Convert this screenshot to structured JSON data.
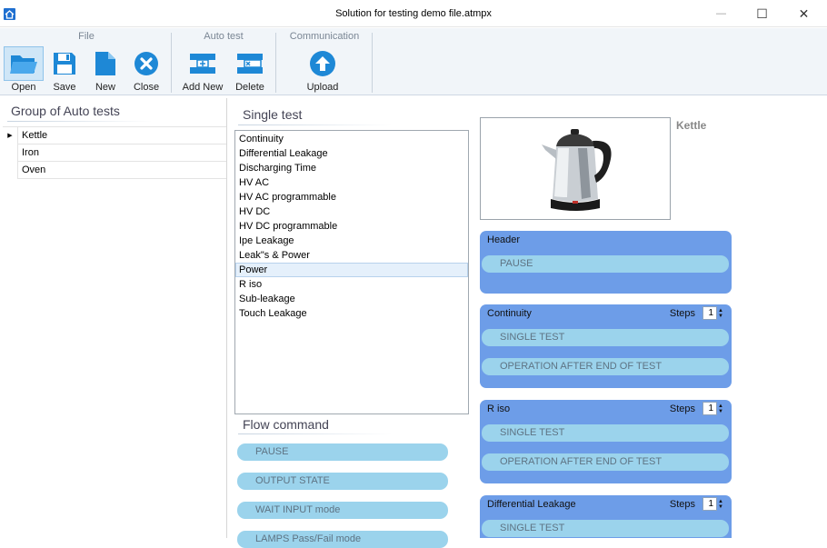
{
  "window": {
    "title": "Solution for testing demo file.atmpx",
    "minimize": "—",
    "maximize": "☐",
    "close": "✕"
  },
  "ribbon": {
    "groups": {
      "file": "File",
      "auto_test": "Auto test",
      "communication": "Communication"
    },
    "buttons": {
      "open": "Open",
      "save": "Save",
      "new": "New",
      "close": "Close",
      "add_new": "Add New",
      "delete": "Delete",
      "upload": "Upload"
    }
  },
  "left": {
    "title": "Group of Auto tests",
    "rows": [
      "Kettle",
      "Iron",
      "Oven"
    ],
    "selected_marker": "▶"
  },
  "single_test": {
    "title": "Single test",
    "items": [
      "Continuity",
      "Differential Leakage",
      "Discharging Time",
      "HV AC",
      "HV AC programmable",
      "HV DC",
      "HV DC programmable",
      "Ipe Leakage",
      "Leak\"s & Power",
      "Power",
      "R iso",
      "Sub-leakage",
      "Touch Leakage"
    ],
    "selected": "Power"
  },
  "flow_command": {
    "title": "Flow command",
    "items": [
      "PAUSE",
      "OUTPUT STATE",
      "WAIT INPUT mode",
      "LAMPS Pass/Fail mode"
    ]
  },
  "preview": {
    "name": "Kettle"
  },
  "sequence": {
    "header": {
      "title": "Header",
      "items": [
        "PAUSE"
      ]
    },
    "steps_label": "Steps",
    "cards": [
      {
        "title": "Continuity",
        "steps": "1",
        "items": [
          "SINGLE TEST",
          "OPERATION AFTER END OF TEST"
        ]
      },
      {
        "title": "R iso",
        "steps": "1",
        "items": [
          "SINGLE TEST",
          "OPERATION AFTER END OF TEST"
        ]
      },
      {
        "title": "Differential Leakage",
        "steps": "1",
        "items": [
          "SINGLE TEST"
        ]
      }
    ]
  },
  "colors": {
    "card": "#6d9de8",
    "pill": "#9bd3ec",
    "ribbon_bg": "#f1f5f9",
    "accent": "#1e88d6"
  }
}
